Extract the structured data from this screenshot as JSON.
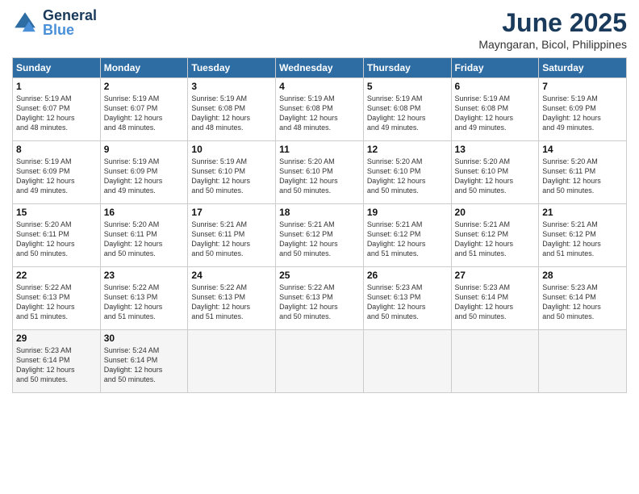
{
  "logo": {
    "text_general": "General",
    "text_blue": "Blue"
  },
  "header": {
    "title": "June 2025",
    "subtitle": "Mayngaran, Bicol, Philippines"
  },
  "weekdays": [
    "Sunday",
    "Monday",
    "Tuesday",
    "Wednesday",
    "Thursday",
    "Friday",
    "Saturday"
  ],
  "days": [
    {
      "num": "1",
      "sunrise": "5:19 AM",
      "sunset": "6:07 PM",
      "daylight": "12 hours and 48 minutes."
    },
    {
      "num": "2",
      "sunrise": "5:19 AM",
      "sunset": "6:07 PM",
      "daylight": "12 hours and 48 minutes."
    },
    {
      "num": "3",
      "sunrise": "5:19 AM",
      "sunset": "6:08 PM",
      "daylight": "12 hours and 48 minutes."
    },
    {
      "num": "4",
      "sunrise": "5:19 AM",
      "sunset": "6:08 PM",
      "daylight": "12 hours and 48 minutes."
    },
    {
      "num": "5",
      "sunrise": "5:19 AM",
      "sunset": "6:08 PM",
      "daylight": "12 hours and 49 minutes."
    },
    {
      "num": "6",
      "sunrise": "5:19 AM",
      "sunset": "6:08 PM",
      "daylight": "12 hours and 49 minutes."
    },
    {
      "num": "7",
      "sunrise": "5:19 AM",
      "sunset": "6:09 PM",
      "daylight": "12 hours and 49 minutes."
    },
    {
      "num": "8",
      "sunrise": "5:19 AM",
      "sunset": "6:09 PM",
      "daylight": "12 hours and 49 minutes."
    },
    {
      "num": "9",
      "sunrise": "5:19 AM",
      "sunset": "6:09 PM",
      "daylight": "12 hours and 49 minutes."
    },
    {
      "num": "10",
      "sunrise": "5:19 AM",
      "sunset": "6:10 PM",
      "daylight": "12 hours and 50 minutes."
    },
    {
      "num": "11",
      "sunrise": "5:20 AM",
      "sunset": "6:10 PM",
      "daylight": "12 hours and 50 minutes."
    },
    {
      "num": "12",
      "sunrise": "5:20 AM",
      "sunset": "6:10 PM",
      "daylight": "12 hours and 50 minutes."
    },
    {
      "num": "13",
      "sunrise": "5:20 AM",
      "sunset": "6:10 PM",
      "daylight": "12 hours and 50 minutes."
    },
    {
      "num": "14",
      "sunrise": "5:20 AM",
      "sunset": "6:11 PM",
      "daylight": "12 hours and 50 minutes."
    },
    {
      "num": "15",
      "sunrise": "5:20 AM",
      "sunset": "6:11 PM",
      "daylight": "12 hours and 50 minutes."
    },
    {
      "num": "16",
      "sunrise": "5:20 AM",
      "sunset": "6:11 PM",
      "daylight": "12 hours and 50 minutes."
    },
    {
      "num": "17",
      "sunrise": "5:21 AM",
      "sunset": "6:11 PM",
      "daylight": "12 hours and 50 minutes."
    },
    {
      "num": "18",
      "sunrise": "5:21 AM",
      "sunset": "6:12 PM",
      "daylight": "12 hours and 50 minutes."
    },
    {
      "num": "19",
      "sunrise": "5:21 AM",
      "sunset": "6:12 PM",
      "daylight": "12 hours and 51 minutes."
    },
    {
      "num": "20",
      "sunrise": "5:21 AM",
      "sunset": "6:12 PM",
      "daylight": "12 hours and 51 minutes."
    },
    {
      "num": "21",
      "sunrise": "5:21 AM",
      "sunset": "6:12 PM",
      "daylight": "12 hours and 51 minutes."
    },
    {
      "num": "22",
      "sunrise": "5:22 AM",
      "sunset": "6:13 PM",
      "daylight": "12 hours and 51 minutes."
    },
    {
      "num": "23",
      "sunrise": "5:22 AM",
      "sunset": "6:13 PM",
      "daylight": "12 hours and 51 minutes."
    },
    {
      "num": "24",
      "sunrise": "5:22 AM",
      "sunset": "6:13 PM",
      "daylight": "12 hours and 51 minutes."
    },
    {
      "num": "25",
      "sunrise": "5:22 AM",
      "sunset": "6:13 PM",
      "daylight": "12 hours and 50 minutes."
    },
    {
      "num": "26",
      "sunrise": "5:23 AM",
      "sunset": "6:13 PM",
      "daylight": "12 hours and 50 minutes."
    },
    {
      "num": "27",
      "sunrise": "5:23 AM",
      "sunset": "6:14 PM",
      "daylight": "12 hours and 50 minutes."
    },
    {
      "num": "28",
      "sunrise": "5:23 AM",
      "sunset": "6:14 PM",
      "daylight": "12 hours and 50 minutes."
    },
    {
      "num": "29",
      "sunrise": "5:23 AM",
      "sunset": "6:14 PM",
      "daylight": "12 hours and 50 minutes."
    },
    {
      "num": "30",
      "sunrise": "5:24 AM",
      "sunset": "6:14 PM",
      "daylight": "12 hours and 50 minutes."
    }
  ],
  "labels": {
    "sunrise": "Sunrise:",
    "sunset": "Sunset:",
    "daylight": "Daylight:"
  }
}
